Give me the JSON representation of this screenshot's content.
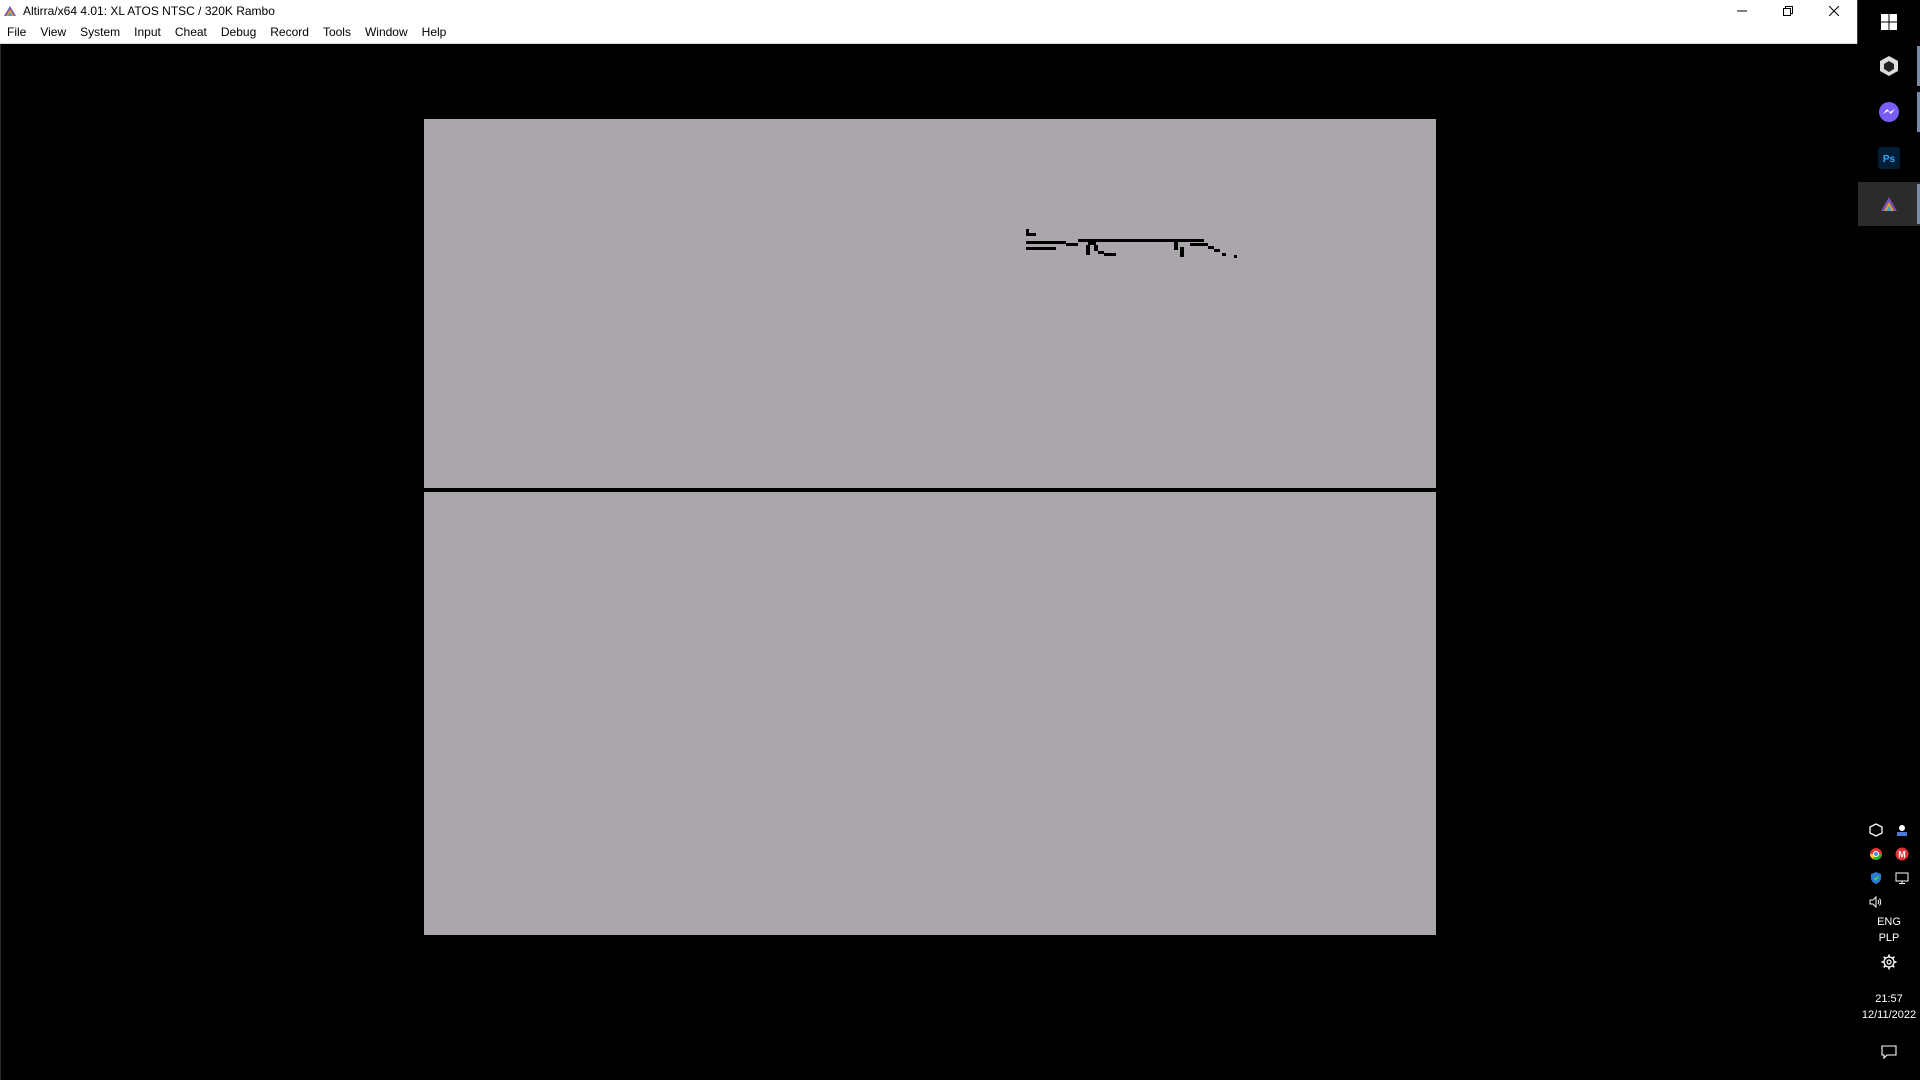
{
  "window": {
    "title": "Altirra/x64 4.01: XL ATOS NTSC / 320K Rambo",
    "controls": {
      "minimize": "minimize-icon",
      "restore": "restore-icon",
      "close": "close-icon"
    }
  },
  "menu": {
    "items": [
      "File",
      "View",
      "System",
      "Input",
      "Cheat",
      "Debug",
      "Record",
      "Tools",
      "Window",
      "Help"
    ]
  },
  "emulator": {
    "background_color": "#aba6ab",
    "horizon_color": "#000000"
  },
  "taskbar": {
    "apps": [
      {
        "name": "windows-start-icon"
      },
      {
        "name": "unity-hub-icon"
      },
      {
        "name": "messenger-icon"
      },
      {
        "name": "photoshop-icon",
        "label": "Ps"
      },
      {
        "name": "altirra-icon"
      }
    ],
    "tray": {
      "language_line1": "ENG",
      "language_line2": "PLP",
      "time": "21:57",
      "date": "12/11/2022"
    }
  }
}
